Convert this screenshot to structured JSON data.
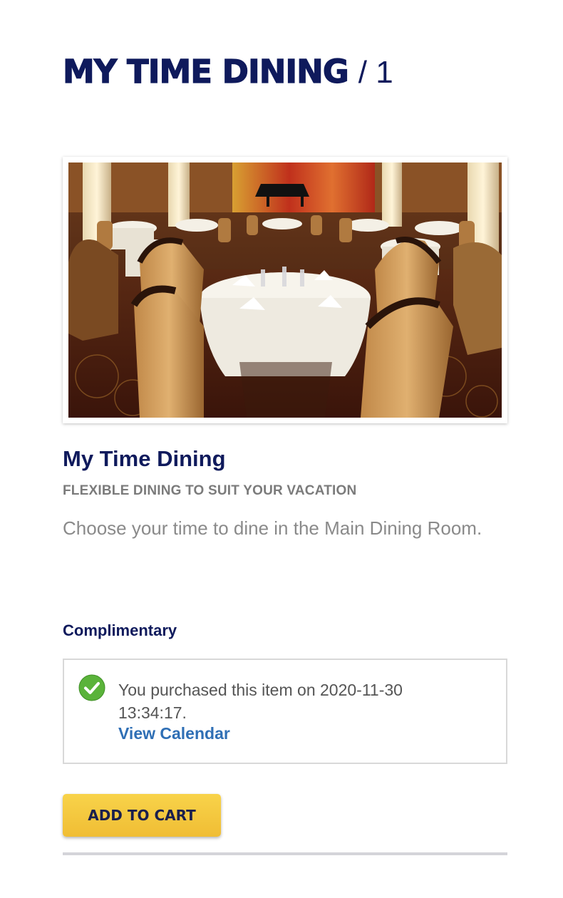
{
  "header": {
    "title": "MY TIME DINING",
    "count": "/ 1"
  },
  "item": {
    "image_alt": "Main Dining Room",
    "title": "My Time Dining",
    "subtitle": "FLEXIBLE DINING TO SUIT YOUR VACATION",
    "description": "Choose your time to dine in the Main Dining Room.",
    "price_label": "Complimentary"
  },
  "purchase": {
    "message": "You purchased this item on 2020-11-30 13:34:17.",
    "link_label": "View Calendar"
  },
  "actions": {
    "add_to_cart_label": "ADD TO CART"
  },
  "colors": {
    "brand_navy": "#0f1a5c",
    "link_blue": "#2f6fb5",
    "button_yellow": "#f5c842",
    "success_green": "#5ab33a"
  },
  "icons": {
    "purchased": "check-circle-icon"
  }
}
